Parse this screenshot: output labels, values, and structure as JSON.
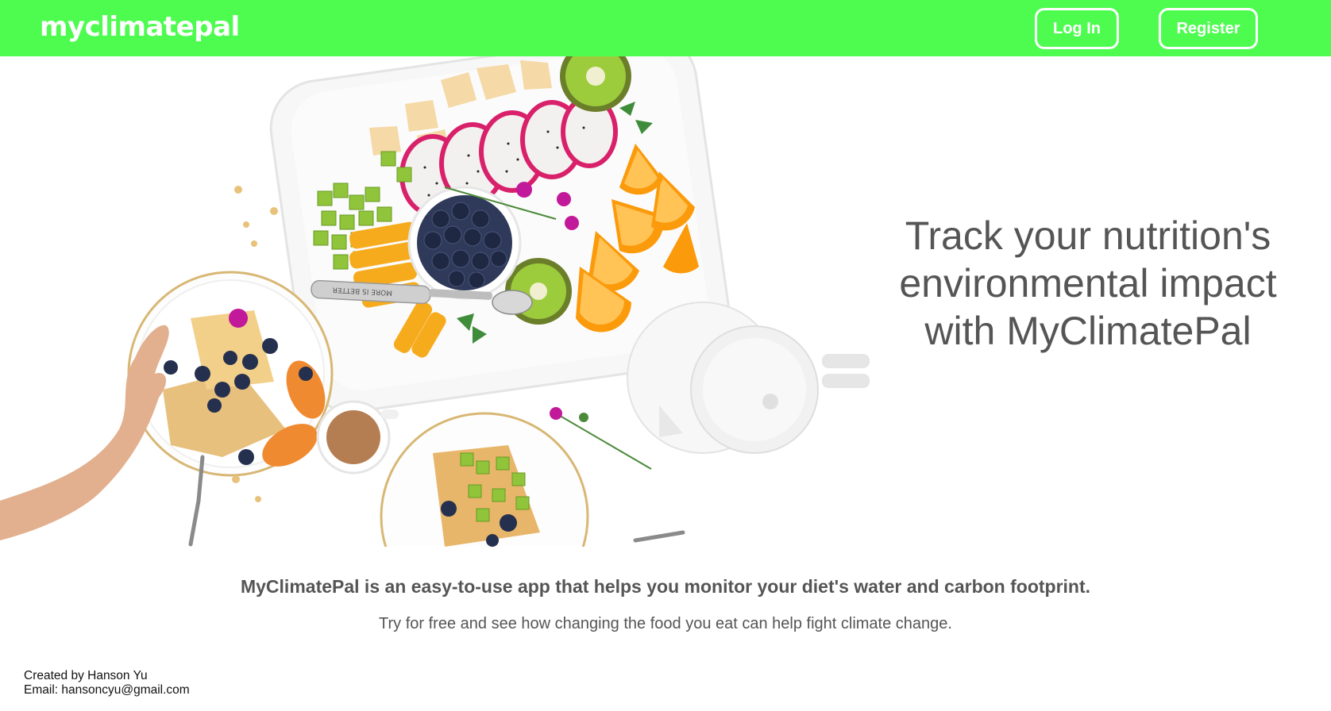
{
  "header": {
    "brand": "myclimatepal",
    "login_label": "Log In",
    "register_label": "Register",
    "accent_color": "#4efc50"
  },
  "hero": {
    "image": "breakfast-table-flatlay",
    "headline": "Track your nutrition's environmental impact with MyClimatePal",
    "spoon_engraving": "MORE IS BETTER"
  },
  "main": {
    "tagline": "MyClimatePal is an easy-to-use app that helps you monitor your diet's water and carbon footprint.",
    "subline": "Try for free and see how changing the food you eat can help fight climate change."
  },
  "footer": {
    "created_by": "Created by Hanson Yu",
    "email": "Email: hansoncyu@gmail.com"
  }
}
